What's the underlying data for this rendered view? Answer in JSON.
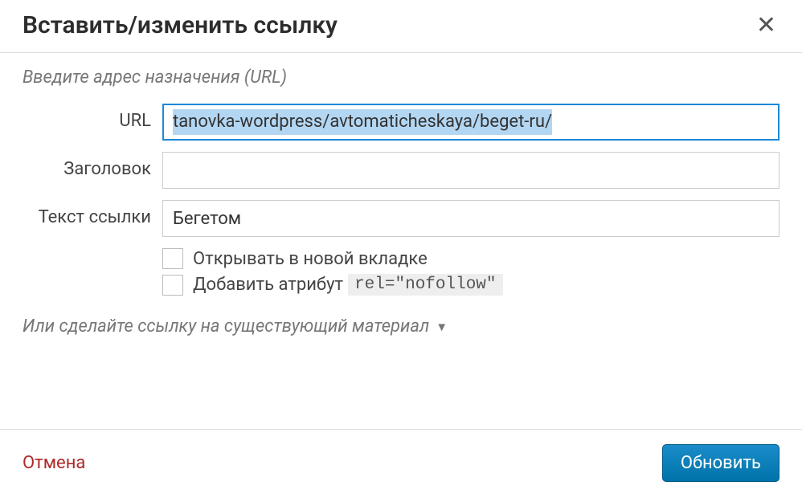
{
  "dialog": {
    "title": "Вставить/изменить ссылку",
    "section_label": "Введите адрес назначения (URL)",
    "fields": {
      "url": {
        "label": "URL",
        "value": "tanovka-wordpress/avtomaticheskaya/beget-ru/"
      },
      "title": {
        "label": "Заголовок",
        "value": ""
      },
      "link_text": {
        "label": "Текст ссылки",
        "value": "Бегетом"
      }
    },
    "checkboxes": {
      "new_tab": {
        "label": "Открывать в новой вкладке",
        "checked": false
      },
      "nofollow": {
        "label_prefix": "Добавить атрибут",
        "code": "rel=\"nofollow\"",
        "checked": false
      }
    },
    "existing_link_label": "Или сделайте ссылку на существующий материал",
    "footer": {
      "cancel": "Отмена",
      "submit": "Обновить"
    }
  }
}
